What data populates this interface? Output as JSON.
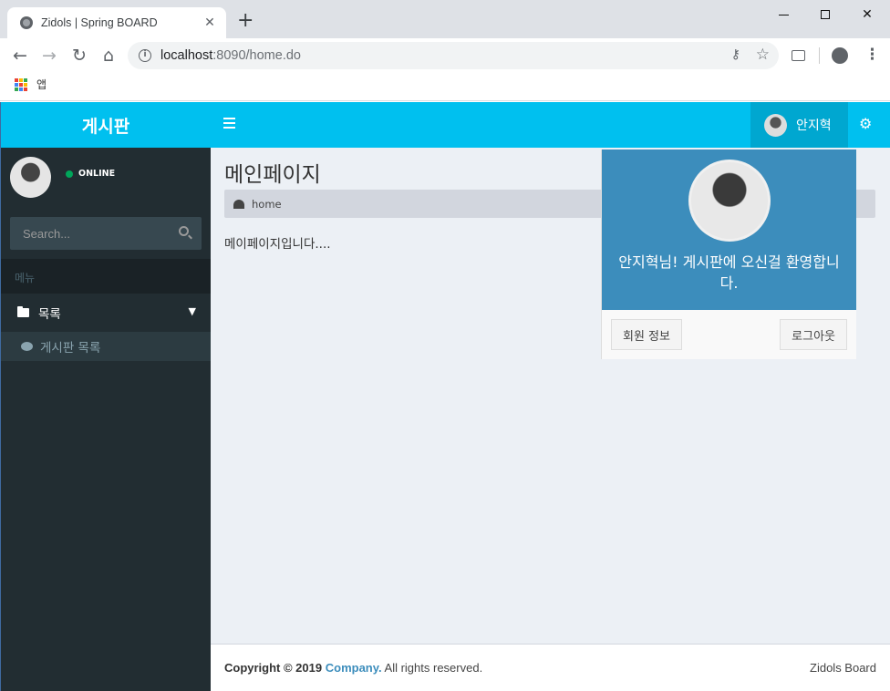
{
  "browser": {
    "tab_title": "Zidols | Spring BOARD",
    "tab_close": "✕",
    "new_tab": "+",
    "url_host": "localhost",
    "url_rest": ":8090/home.do",
    "bookmark_apps": "앱"
  },
  "app": {
    "logo": "게시판",
    "user_name": "안지혁",
    "accent_color": "#00c0ef"
  },
  "sidebar": {
    "status": "ONLINE",
    "search_placeholder": "Search...",
    "header": "메뉴",
    "tree_label": "목록",
    "sub_item": "게시판 목록"
  },
  "content": {
    "title": "메인페이지",
    "breadcrumb": "home",
    "body": "메이페이지입니다...."
  },
  "dropdown": {
    "greeting": "안지혁님! 게시판에 오신걸 환영합니다.",
    "profile_button": "회원 정보",
    "logout_button": "로그아웃"
  },
  "footer": {
    "copyright": "Copyright © 2019",
    "company": "Company.",
    "rights": "All rights reserved.",
    "brand": "Zidols Board"
  }
}
